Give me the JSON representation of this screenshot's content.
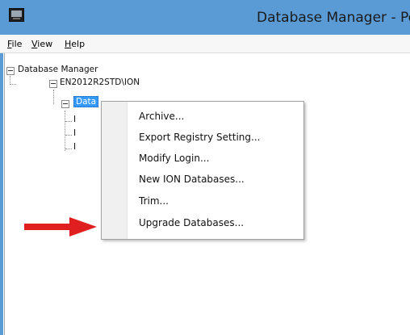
{
  "window": {
    "title": "Database Manager - Po"
  },
  "menubar": {
    "items": [
      {
        "accel": "F",
        "rest": "ile"
      },
      {
        "accel": "V",
        "rest": "iew"
      },
      {
        "accel": "H",
        "rest": "elp"
      }
    ]
  },
  "tree": {
    "root": "Database Manager",
    "server": "EN2012R2STD\\ION",
    "selected": "Data",
    "children_stub": [
      "I",
      "I",
      "I"
    ]
  },
  "context_menu": {
    "items": [
      "Archive...",
      "Export Registry Setting...",
      "Modify Login...",
      "New ION Databases...",
      "Trim...",
      "Upgrade Databases..."
    ]
  },
  "colors": {
    "titlebar": "#5b9bd5",
    "selection": "#3399ff",
    "arrow": "#e02020"
  },
  "icons": {
    "app": "computer-monitor-icon",
    "callout": "red-arrow-right-icon"
  }
}
